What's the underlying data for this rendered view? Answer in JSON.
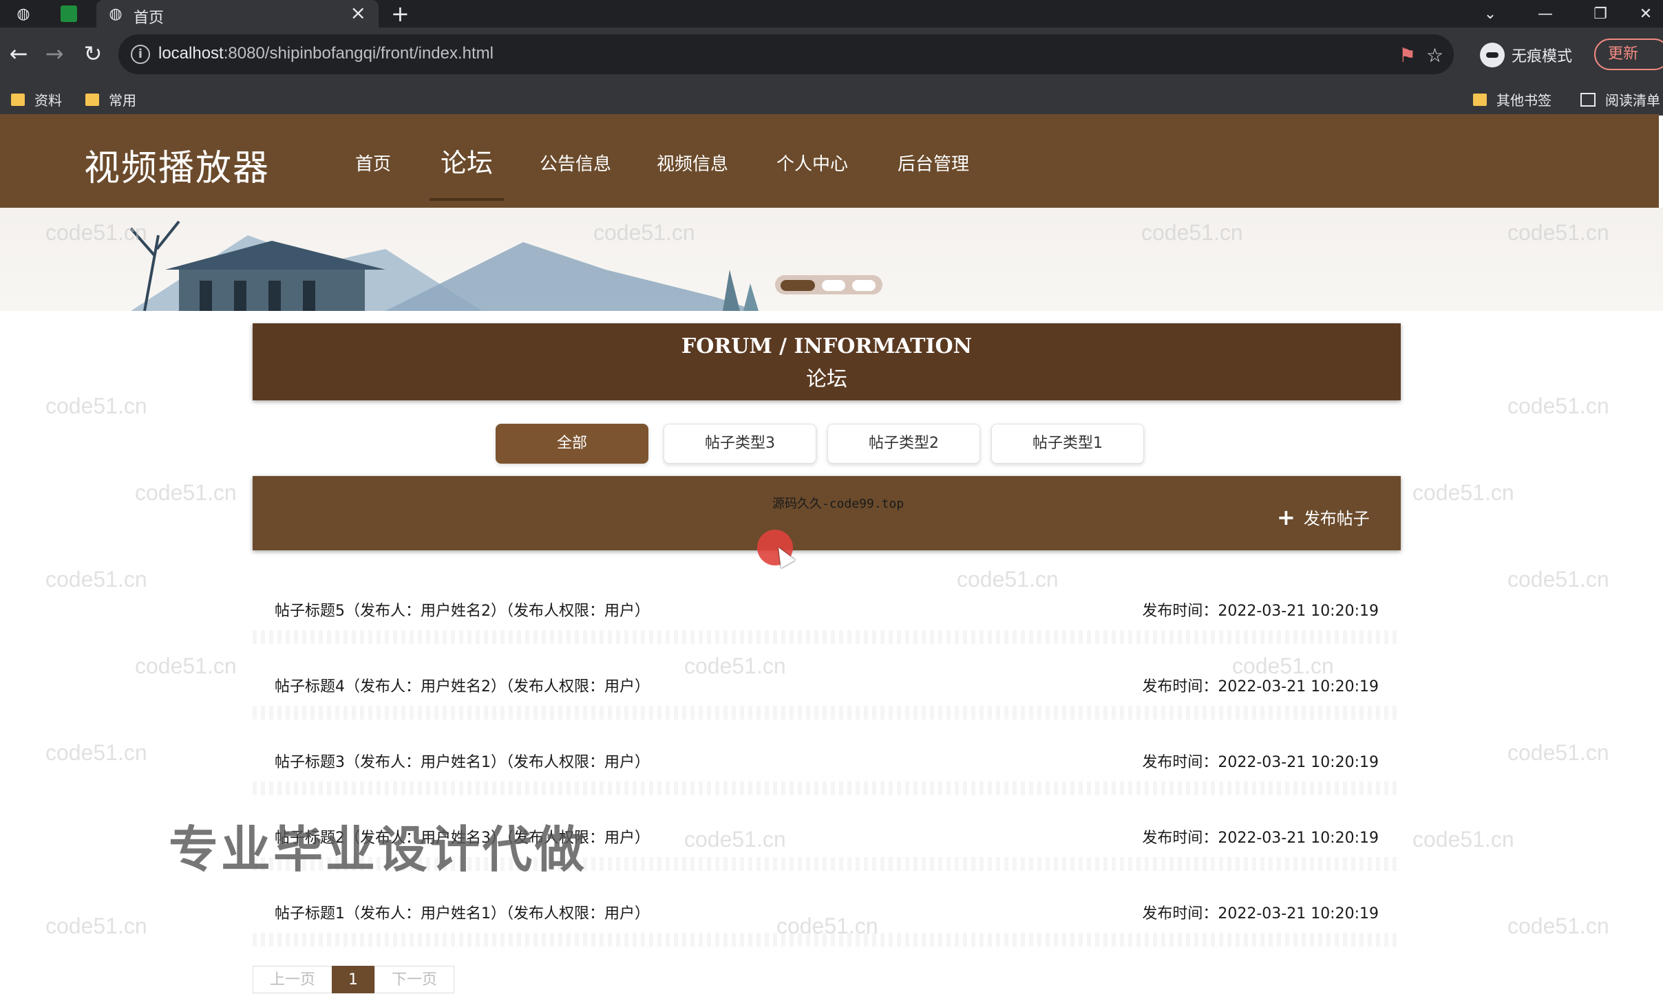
{
  "browser": {
    "tab_title": "首页",
    "url_host": "localhost",
    "url_rest": ":8080/shipinbofangqi/front/index.html",
    "profile_label": "无痕模式",
    "update_label": "更新",
    "bookmarks": [
      "资料",
      "常用"
    ],
    "bookmarks_right": [
      "其他书签",
      "阅读清单"
    ]
  },
  "site": {
    "logo": "视频播放器",
    "nav": [
      "首页",
      "论坛",
      "公告信息",
      "视频信息",
      "个人中心",
      "后台管理"
    ],
    "active_nav": "论坛"
  },
  "forum": {
    "title_en": "FORUM / INFORMATION",
    "title_cn": "论坛",
    "filters": [
      "全部",
      "帖子类型3",
      "帖子类型2",
      "帖子类型1"
    ],
    "active_filter": "全部",
    "site_mark": "源码久久-code99.top",
    "post_button": "发布帖子",
    "posts": [
      {
        "title": "帖子标题5（发布人：用户姓名2）（发布人权限：用户）",
        "time": "发布时间：2022-03-21 10:20:19"
      },
      {
        "title": "帖子标题4（发布人：用户姓名2）（发布人权限：用户）",
        "time": "发布时间：2022-03-21 10:20:19"
      },
      {
        "title": "帖子标题3（发布人：用户姓名1）（发布人权限：用户）",
        "time": "发布时间：2022-03-21 10:20:19"
      },
      {
        "title": "帖子标题2（发布人：用户姓名3）（发布人权限：用户）",
        "time": "发布时间：2022-03-21 10:20:19"
      },
      {
        "title": "帖子标题1（发布人：用户姓名1）（发布人权限：用户）",
        "time": "发布时间：2022-03-21 10:20:19"
      }
    ],
    "pagination": {
      "prev": "上一页",
      "current": "1",
      "next": "下一页"
    }
  },
  "overlays": {
    "watermark": "code51.cn",
    "ad_text": "专业毕业设计代做"
  },
  "colors": {
    "brand_brown": "#6b4b2c",
    "dark_brown": "#5b3a22"
  }
}
